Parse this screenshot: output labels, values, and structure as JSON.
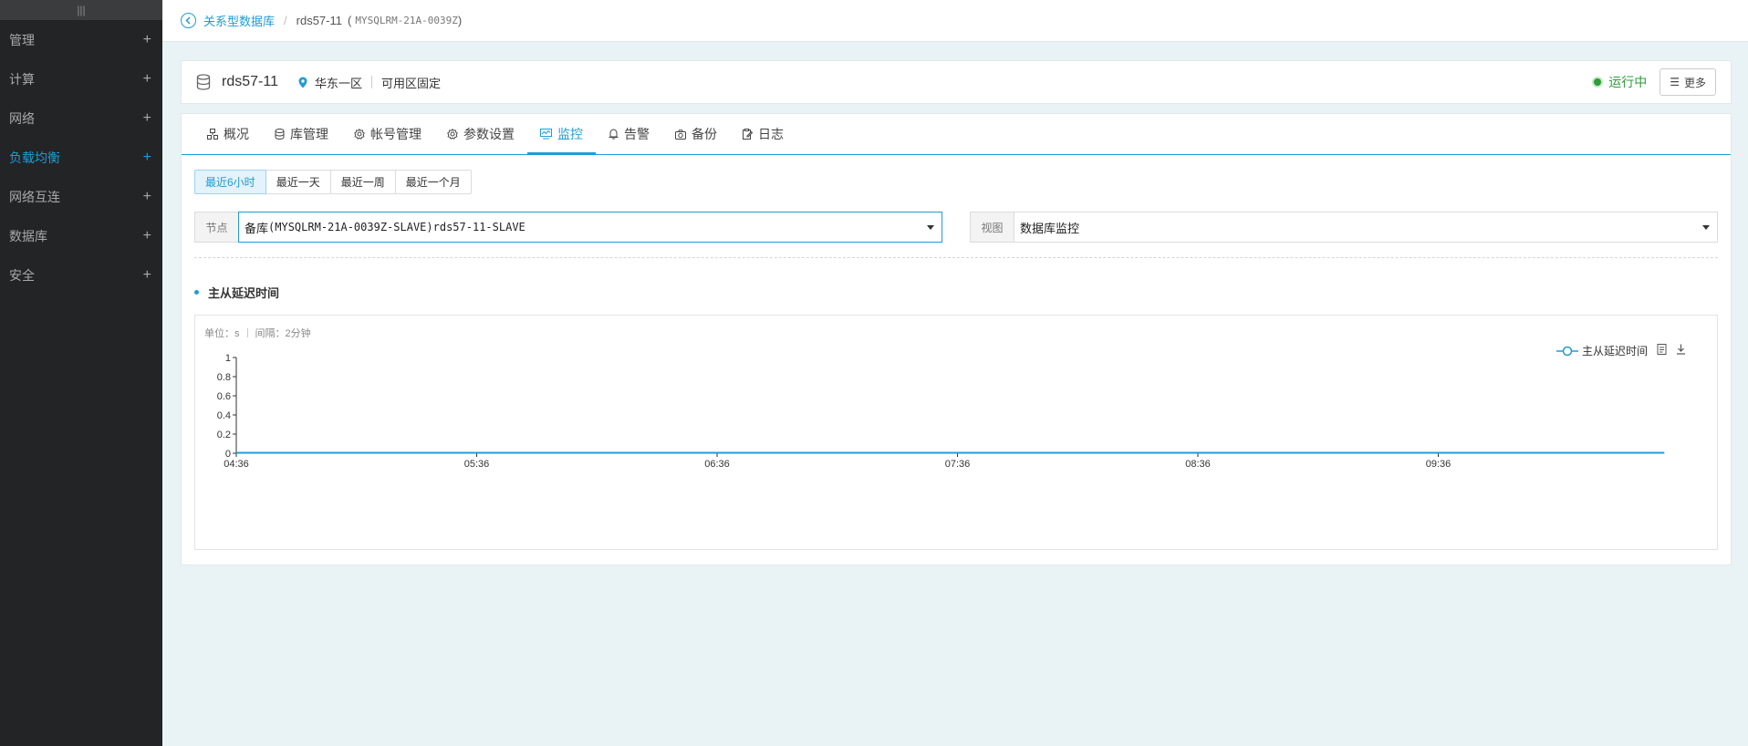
{
  "sidebar": {
    "top_glyph": "|||",
    "items": [
      {
        "label": "管理",
        "active": false
      },
      {
        "label": "计算",
        "active": false
      },
      {
        "label": "网络",
        "active": false
      },
      {
        "label": "负载均衡",
        "active": true
      },
      {
        "label": "网络互连",
        "active": false
      },
      {
        "label": "数据库",
        "active": false
      },
      {
        "label": "安全",
        "active": false
      }
    ],
    "expand_glyph": "+"
  },
  "breadcrumb": {
    "parent": "关系型数据库",
    "separator": "/",
    "current": "rds57-11",
    "id_open": "(",
    "id": "MYSQLRM-21A-0039Z",
    "id_close": ")"
  },
  "instance": {
    "name": "rds57-11",
    "region": "华东一区",
    "zone": "可用区固定",
    "status": "运行中",
    "more_label": "更多"
  },
  "tabs": [
    {
      "label": "概况",
      "icon": "overview-icon",
      "active": false
    },
    {
      "label": "库管理",
      "icon": "database-icon",
      "active": false
    },
    {
      "label": "帐号管理",
      "icon": "account-gear-icon",
      "active": false
    },
    {
      "label": "参数设置",
      "icon": "settings-gear-icon",
      "active": false
    },
    {
      "label": "监控",
      "icon": "monitor-icon",
      "active": true
    },
    {
      "label": "告警",
      "icon": "bell-icon",
      "active": false
    },
    {
      "label": "备份",
      "icon": "camera-icon",
      "active": false
    },
    {
      "label": "日志",
      "icon": "log-icon",
      "active": false
    }
  ],
  "time_ranges": [
    {
      "label": "最近6小时",
      "active": true
    },
    {
      "label": "最近一天",
      "active": false
    },
    {
      "label": "最近一周",
      "active": false
    },
    {
      "label": "最近一个月",
      "active": false
    }
  ],
  "node_select": {
    "label": "节点",
    "value_prefix": "备库",
    "value_rest": "(MYSQLRM-21A-0039Z-SLAVE)rds57-11-SLAVE"
  },
  "view_select": {
    "label": "视图",
    "value": "数据库监控"
  },
  "section": {
    "title": "主从延迟时间"
  },
  "chart_meta": {
    "unit": "单位：s",
    "interval": "间隔：2分钟"
  },
  "chart_data": {
    "type": "line",
    "title": "",
    "xlabel": "",
    "ylabel": "",
    "x_ticks": [
      "04:36",
      "05:36",
      "06:36",
      "07:36",
      "08:36",
      "09:36"
    ],
    "y_ticks": [
      "0",
      "0.2",
      "0.4",
      "0.6",
      "0.8",
      "1"
    ],
    "ylim": [
      0,
      1
    ],
    "x_range_hours": [
      0,
      5.94
    ],
    "series": [
      {
        "name": "主从延迟时间",
        "x_hours": [
          0,
          5.94
        ],
        "values": [
          0,
          0
        ]
      }
    ],
    "legend_position": "top-right",
    "grid": false,
    "line_color": "#1e9cd7"
  }
}
